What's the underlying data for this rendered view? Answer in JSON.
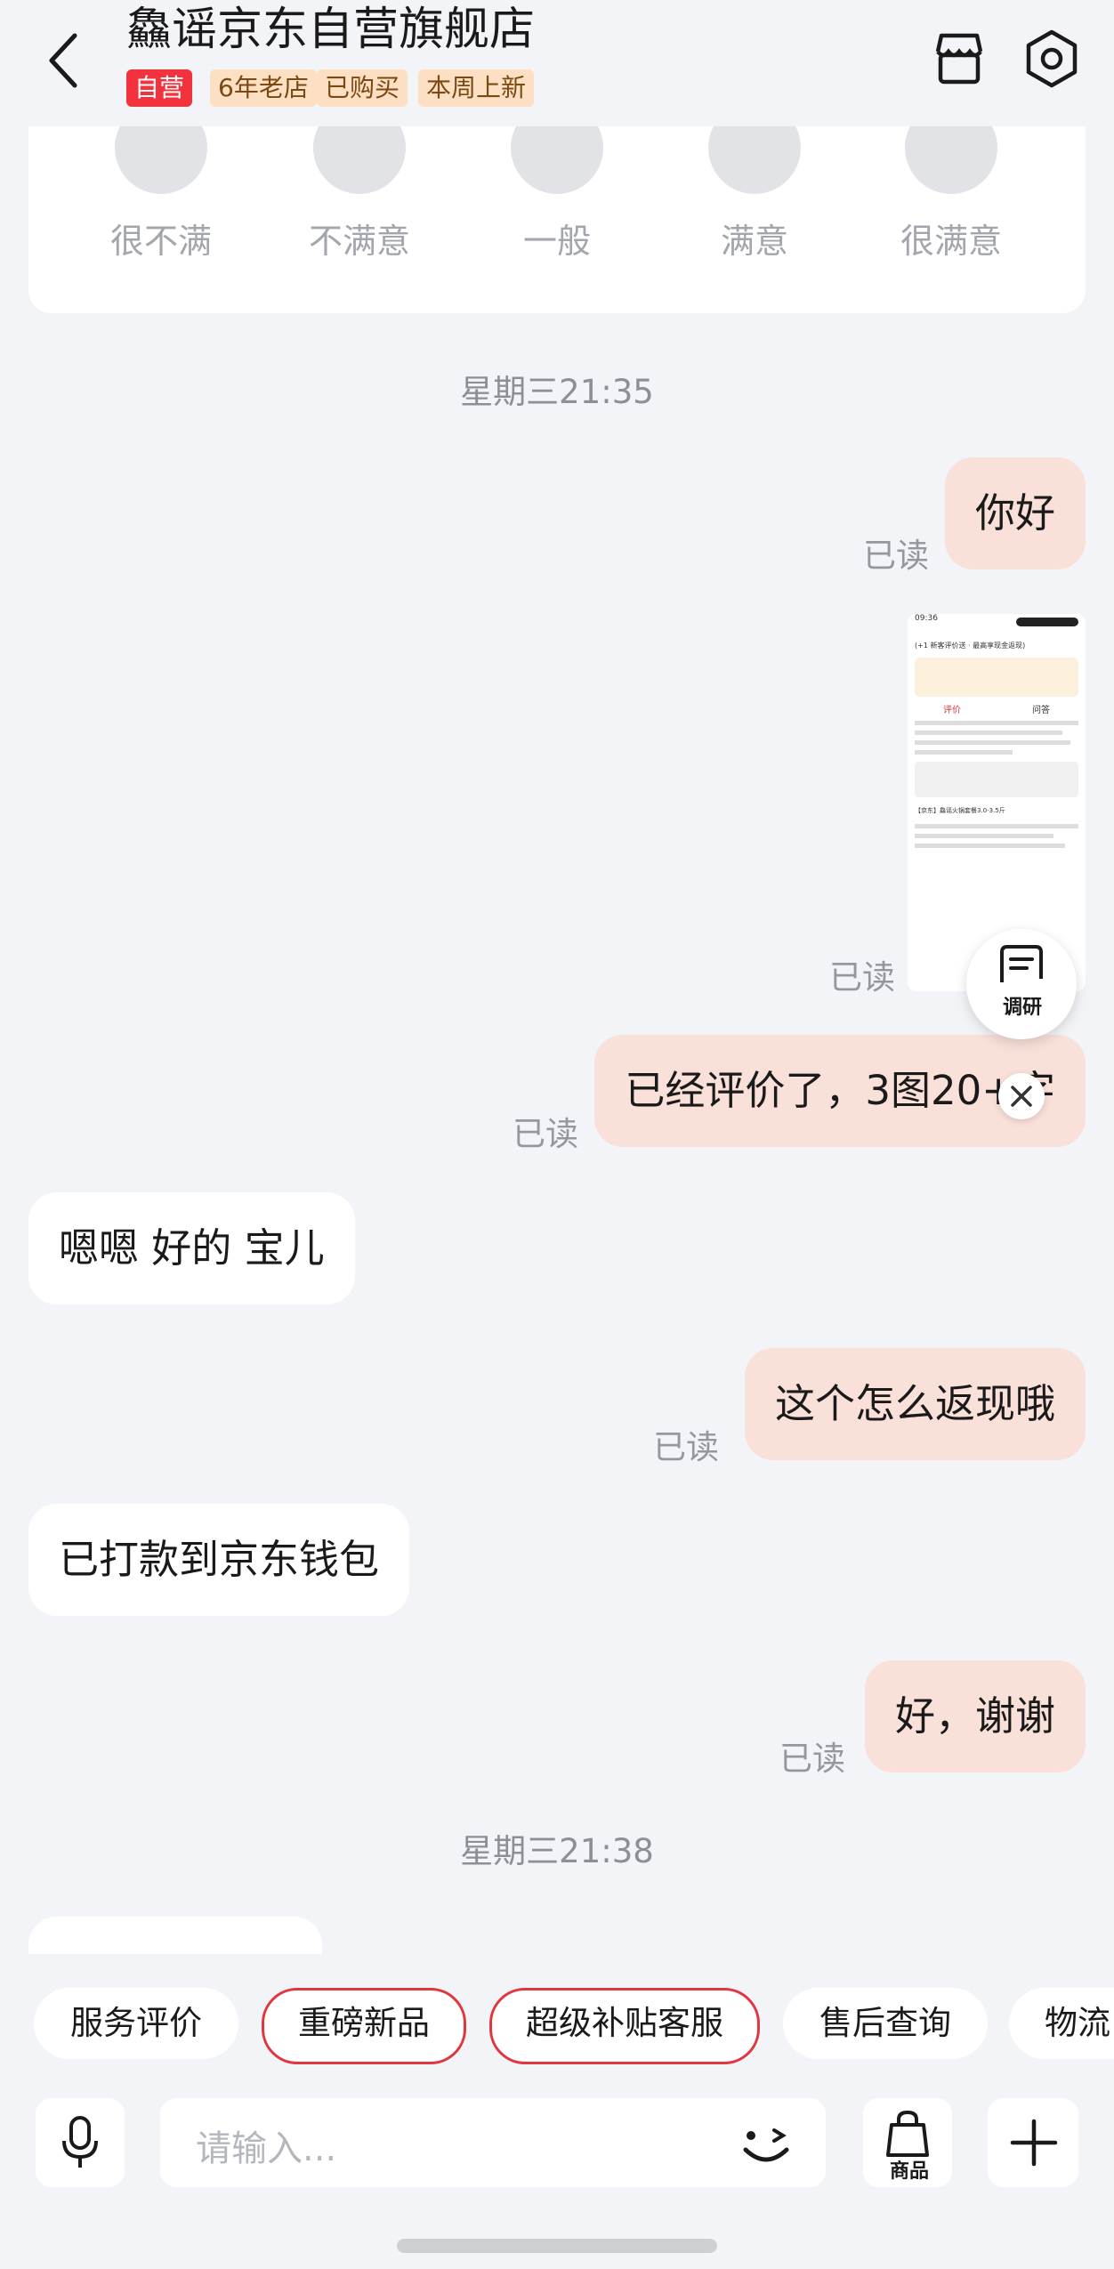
{
  "header": {
    "shop_name": "鱻谣京东自营旗舰店",
    "tags": [
      "自营",
      "6年老店",
      "已购买",
      "本周上新"
    ]
  },
  "rating": {
    "options": [
      "很不满",
      "不满意",
      "一般",
      "满意",
      "很满意"
    ]
  },
  "messages": {
    "timestamp_1": "星期三21:35",
    "read_label": "已读",
    "m1": "你好",
    "m3": "已经评价了，3图20+字",
    "m4": "嗯嗯 好的 宝儿",
    "m5": "这个怎么返现哦",
    "m6": "已打款到京东钱包",
    "m7": "好，谢谢",
    "timestamp_2": "星期三21:38"
  },
  "screenshot_preview": {
    "time": "09:36",
    "title": "(+1 新客评价送 · 最高享现金返现)",
    "tab_review": "评价",
    "tab_qa": "问答",
    "product": "【京东】鱻谣火锅套餐3.0-3.5斤"
  },
  "floating": {
    "survey_label": "调研"
  },
  "quick_replies": [
    "服务评价",
    "重磅新品",
    "超级补贴客服",
    "售后查询",
    "物流"
  ],
  "input": {
    "placeholder": "请输入...",
    "goods_label": "商品"
  },
  "colors": {
    "accent": "#e0373f",
    "my_bubble": "#f9e0d9",
    "background": "#f3f4f8"
  }
}
